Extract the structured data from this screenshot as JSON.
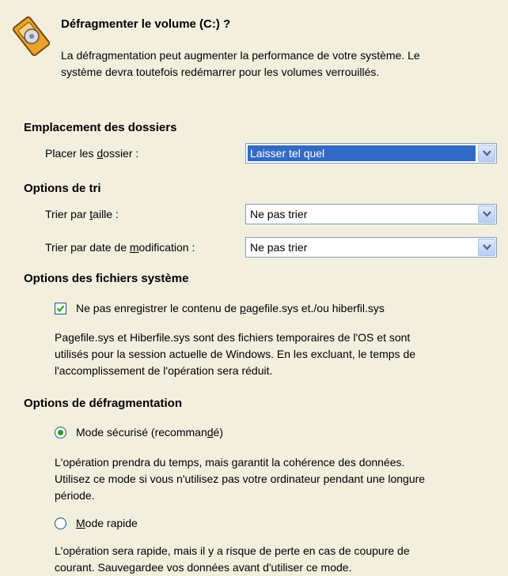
{
  "header": {
    "title": "Défragmenter le volume (C:) ?",
    "description_line1": "La défragmentation peut augmenter la performance de votre système. Le",
    "description_line2": "système devra toutefois redémarrer pour les volumes verrouillés."
  },
  "folders": {
    "heading": "Emplacement des dossiers",
    "place_label_pre": "Placer les ",
    "place_label_key": "d",
    "place_label_post": "ossier :",
    "place_value": "Laisser tel quel"
  },
  "sort": {
    "heading": "Options de tri",
    "size_label_pre": "Trier par ",
    "size_label_key": "t",
    "size_label_post": "aille :",
    "size_value": "Ne pas trier",
    "date_label_pre": "Trier par date de ",
    "date_label_key": "m",
    "date_label_post": "odification :",
    "date_value": "Ne pas trier"
  },
  "system_files": {
    "heading": "Options des fichiers système",
    "checkbox_label_pre": "Ne pas enregistrer le contenu de ",
    "checkbox_label_key": "p",
    "checkbox_label_post": "agefile.sys et./ou hiberfil.sys",
    "checked": true,
    "note_line1": "Pagefile.sys et Hiberfile.sys sont des fichiers temporaires de l'OS et sont",
    "note_line2": "utilisés pour la session actuelle de Windows. En les excluant, le temps de",
    "note_line3": "l'accomplissement de l'opération sera réduit."
  },
  "defrag": {
    "heading": "Options de défragmentation",
    "safe_label_pre": "Mode sécurisé (recomman",
    "safe_label_key": "d",
    "safe_label_post": "é)",
    "safe_selected": true,
    "safe_note_line1": "L'opération prendra du temps, mais garantit la cohérence des données.",
    "safe_note_line2": "Utilisez ce mode si vous n'utilisez pas votre ordinateur pendant une longure",
    "safe_note_line3": "période.",
    "fast_label_key": "M",
    "fast_label_post": "ode rapide",
    "fast_selected": false,
    "fast_note_line1": "L'opération sera rapide, mais il y a risque de perte en cas de coupure de",
    "fast_note_line2": "courant. Sauvegardee vos données avant d'utiliser ce mode."
  },
  "colors": {
    "background": "#f2efdf",
    "selection": "#316ac5",
    "radio_dot": "#21a121",
    "check": "#21a121"
  },
  "icons": {
    "header": "disk-defrag-icon",
    "dropdown": "chevron-down-icon"
  }
}
